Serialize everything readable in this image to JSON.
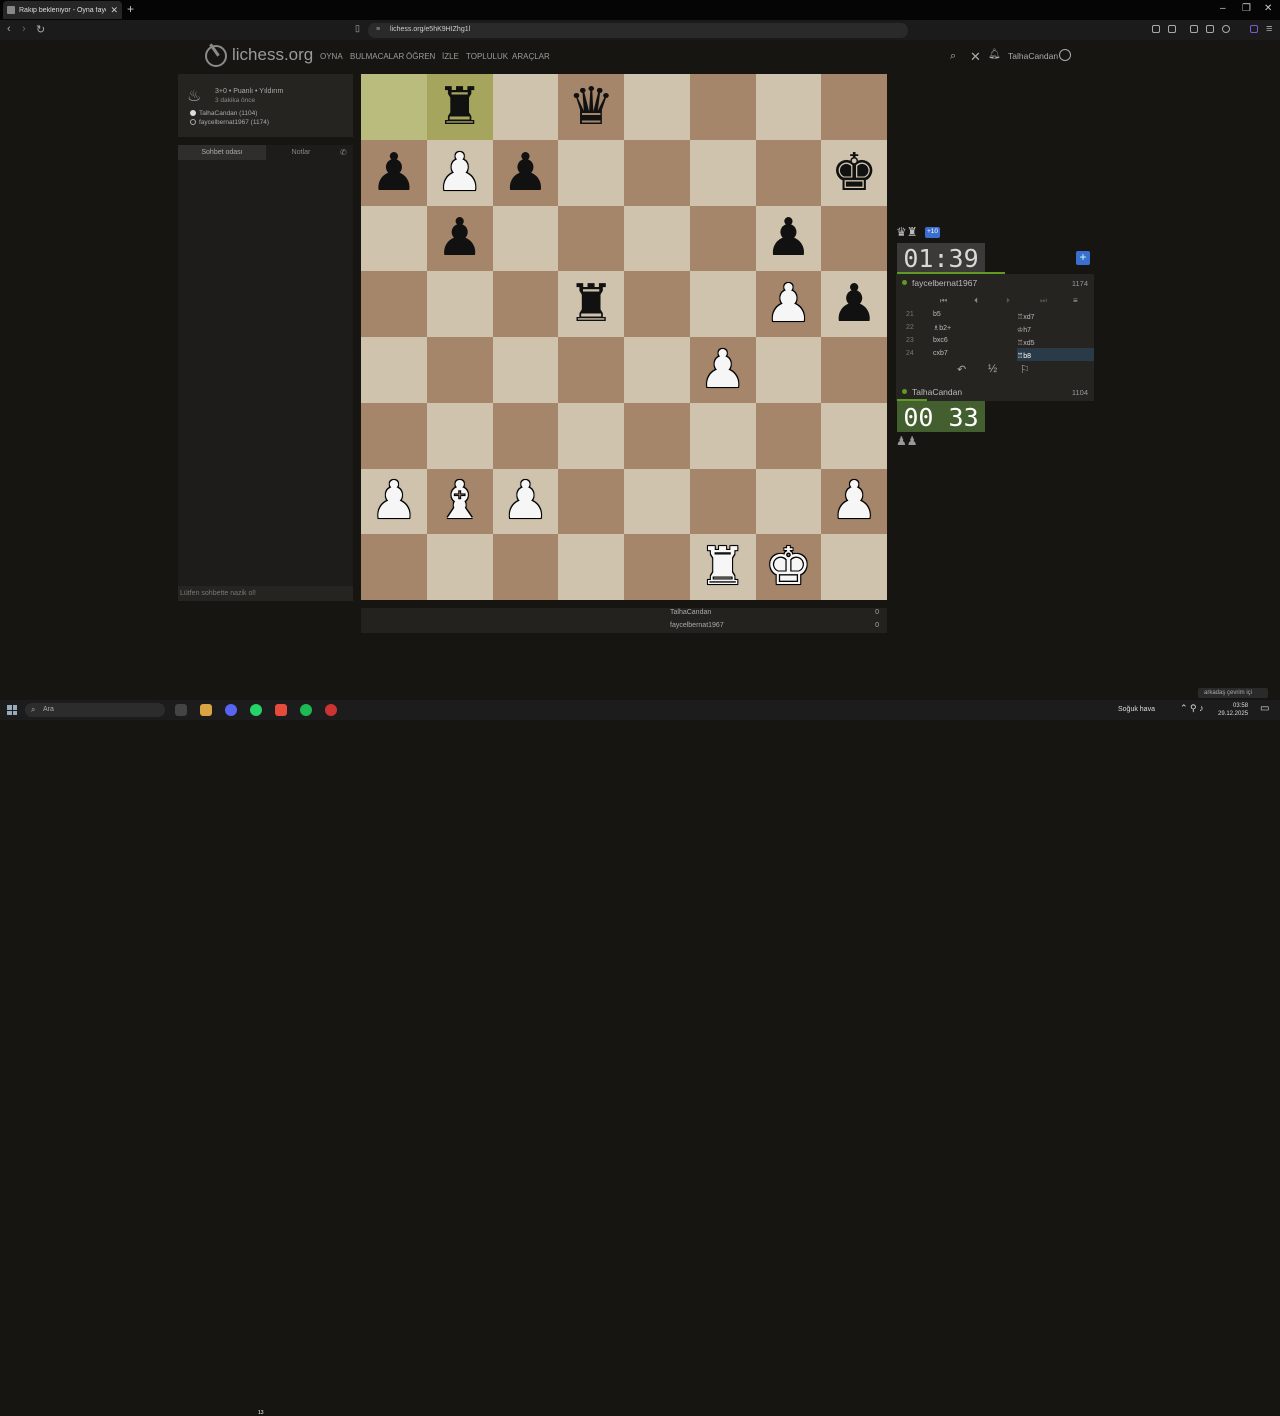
{
  "browser": {
    "tab_title": "Rakip bekleniyor - Oyna fayc",
    "url": "lichess.org/e5hK9HIZhg1l",
    "new_tab": "+",
    "tab_close": "✕"
  },
  "header": {
    "logo": "lichess.org",
    "menu": [
      "OYNA",
      "BULMACALAR",
      "ÖĞREN",
      "İZLE",
      "TOPLULUK",
      "ARAÇLAR"
    ],
    "username": "TalhaCandan"
  },
  "game_info": {
    "type": "3+0 • Puanlı • Yıldırım",
    "ago": "3 dakika önce",
    "white": "TalhaCandan (1104)",
    "black": "faycelbernat1967 (1174)"
  },
  "chat": {
    "tab_room": "Sohbet odası",
    "tab_notes": "Notlar",
    "placeholder": "Lütfen sohbette nazik ol!"
  },
  "board": {
    "ranks": [
      [
        "",
        "bR",
        "",
        "bQ",
        "",
        "",
        "",
        ""
      ],
      [
        "bP",
        "wP",
        "bP",
        "",
        "",
        "",
        "",
        "bK"
      ],
      [
        "",
        "bP",
        "",
        "",
        "",
        "",
        "bP",
        ""
      ],
      [
        "",
        "",
        "",
        "bR",
        "",
        "",
        "wP",
        "bP"
      ],
      [
        "",
        "",
        "",
        "",
        "",
        "wP",
        "",
        ""
      ],
      [
        "",
        "",
        "",
        "",
        "",
        "",
        "",
        ""
      ],
      [
        "wP",
        "wB",
        "wP",
        "",
        "",
        "",
        "",
        "wP"
      ],
      [
        "",
        "",
        "",
        "",
        "",
        "wR",
        "wK",
        ""
      ]
    ],
    "last_move": [
      "a8",
      "b8"
    ]
  },
  "opponent": {
    "name": "faycelbernat1967",
    "rating": "1174",
    "clock": "01:39",
    "material_diff": "+10",
    "captured": "♛♜"
  },
  "player": {
    "name": "TalhaCandan",
    "rating": "1104",
    "clock": "00 33",
    "captured": "♟♟"
  },
  "moves": [
    {
      "no": "21",
      "white": "b5",
      "black": "♖xd7"
    },
    {
      "no": "22",
      "white": "♗b2+",
      "black": "♔h7"
    },
    {
      "no": "23",
      "white": "bxc6",
      "black": "♖xd5"
    },
    {
      "no": "24",
      "white": "cxb7",
      "black": "♖b8",
      "active": true
    }
  ],
  "score": [
    {
      "name": "TalhaCandan",
      "score": "0"
    },
    {
      "name": "faycelbernat1967",
      "score": "0"
    }
  ],
  "actions": {
    "draw": "½"
  },
  "taskbar": {
    "search": "Ara",
    "weather": "Soğuk hava",
    "time": "03:58",
    "date": "29.12.2025",
    "notification": "arkadaş çevrim içi",
    "badge": "13"
  },
  "colors": {
    "light_square": "#cfc3ad",
    "dark_square": "#a5866a",
    "last_move_light": "#b9bc7c",
    "last_move_dark": "#a5a55e",
    "accent_blue": "#3a6fd0",
    "online_green": "#629924"
  }
}
